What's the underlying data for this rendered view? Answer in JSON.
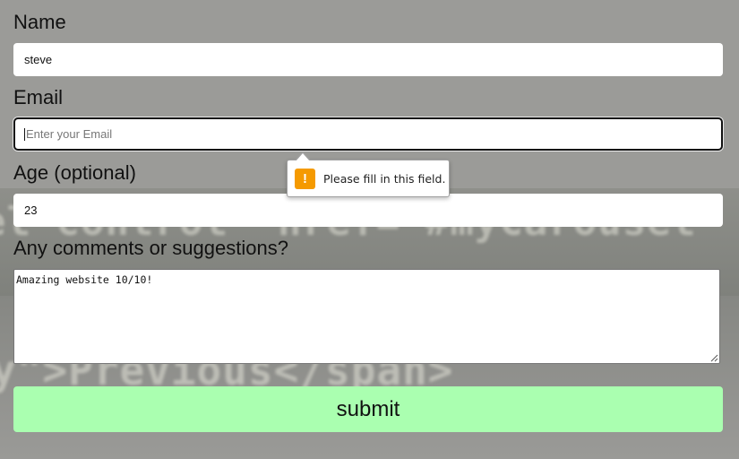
{
  "form": {
    "name_label": "Name",
    "name_value": "steve",
    "email_label": "Email",
    "email_placeholder": "Enter your Email",
    "age_label": "Age (optional)",
    "age_value": "23",
    "comments_label": "Any comments or suggestions?",
    "comments_value": "Amazing website 10/10!",
    "submit_label": "submit"
  },
  "validation": {
    "message": "Please fill in this field.",
    "icon": "warning-icon",
    "icon_glyph": "!",
    "icon_color": "#f59a00"
  },
  "background": {
    "code_line_1": "el control\" href=\"#myCarousel\"",
    "code_line_2": "y\">Previous</span>"
  },
  "colors": {
    "submit_bg": "#aaffb0",
    "page_bg": "#9a9a98"
  }
}
